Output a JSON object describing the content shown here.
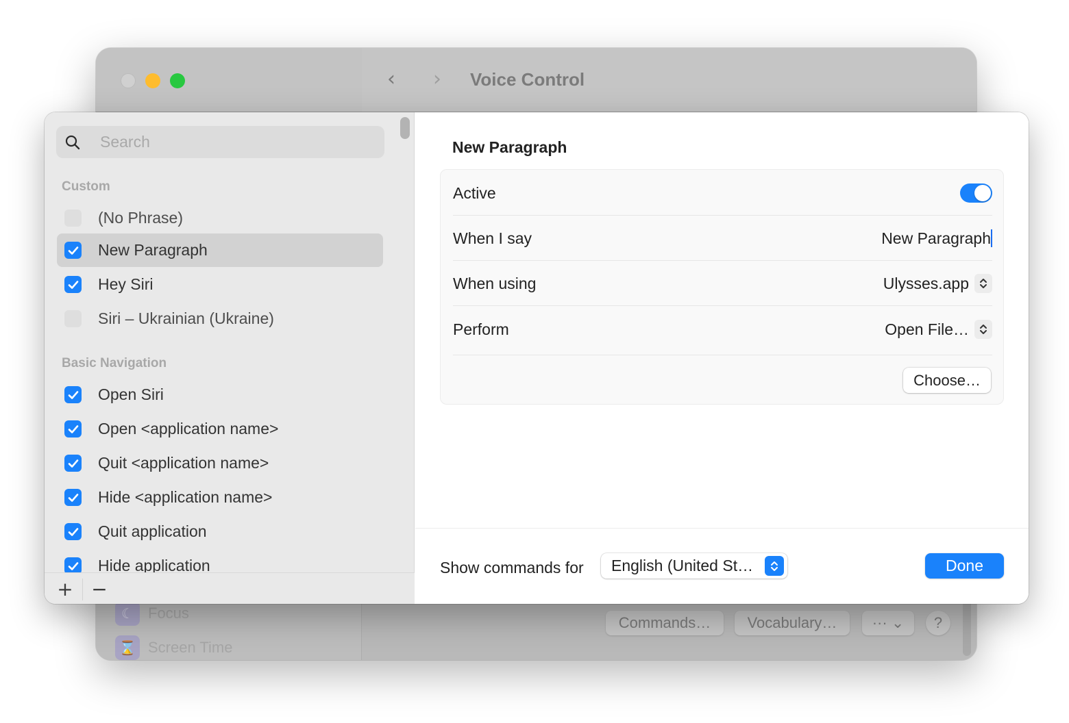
{
  "background_window": {
    "title": "Voice Control",
    "sidebar_items": [
      {
        "label": "Focus",
        "icon": "moon-icon"
      },
      {
        "label": "Screen Time",
        "icon": "hourglass-icon"
      }
    ],
    "buttons": {
      "commands": "Commands…",
      "vocabulary": "Vocabulary…",
      "more": "··· ⌄",
      "help": "?"
    }
  },
  "sheet": {
    "search": {
      "placeholder": "Search",
      "value": ""
    },
    "sections": [
      {
        "header": "Custom",
        "items": [
          {
            "label": "(No Phrase)",
            "checked": false,
            "selected": false
          },
          {
            "label": "New Paragraph",
            "checked": true,
            "selected": true
          },
          {
            "label": "Hey Siri",
            "checked": true,
            "selected": false
          },
          {
            "label": "Siri – Ukrainian (Ukraine)",
            "checked": false,
            "selected": false
          }
        ]
      },
      {
        "header": "Basic Navigation",
        "items": [
          {
            "label": "Open Siri",
            "checked": true
          },
          {
            "label": "Open <application name>",
            "checked": true
          },
          {
            "label": "Quit <application name>",
            "checked": true
          },
          {
            "label": "Hide <application name>",
            "checked": true
          },
          {
            "label": "Quit application",
            "checked": true
          },
          {
            "label": "Hide application",
            "checked": true
          }
        ]
      }
    ],
    "list_footer": {
      "add": "+",
      "remove": "−"
    },
    "detail": {
      "title": "New Paragraph",
      "active_label": "Active",
      "active": true,
      "when_i_say_label": "When I say",
      "when_i_say_value": "New Paragraph",
      "when_using_label": "When using",
      "when_using_value": "Ulysses.app",
      "perform_label": "Perform",
      "perform_value": "Open File…",
      "choose_label": "Choose…"
    },
    "footer": {
      "show_commands_label": "Show commands for",
      "language_value": "English (United St…",
      "done_label": "Done"
    }
  },
  "colors": {
    "accent": "#1a82fb",
    "traffic_close": "#d0d0d0",
    "traffic_minimize": "#febc2e",
    "traffic_maximize": "#28c840"
  }
}
